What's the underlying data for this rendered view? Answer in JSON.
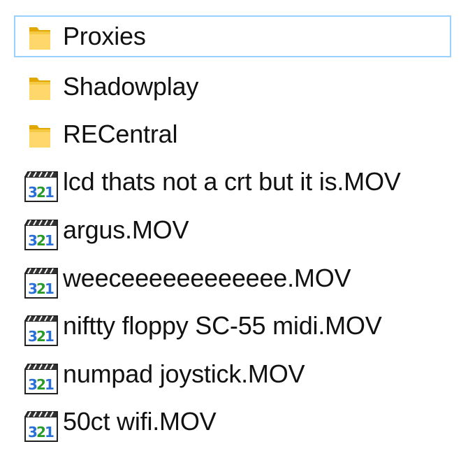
{
  "file_list": {
    "items": [
      {
        "name": "Proxies",
        "type": "folder",
        "selected": true
      },
      {
        "name": "Shadowplay",
        "type": "folder",
        "selected": false
      },
      {
        "name": "RECentral",
        "type": "folder",
        "selected": false
      },
      {
        "name": "lcd thats not a crt but it is.MOV",
        "type": "video",
        "selected": false
      },
      {
        "name": "argus.MOV",
        "type": "video",
        "selected": false
      },
      {
        "name": "weeceeeeeeeeeeee.MOV",
        "type": "video",
        "selected": false
      },
      {
        "name": "niftty floppy SC-55 midi.MOV",
        "type": "video",
        "selected": false
      },
      {
        "name": "numpad joystick.MOV",
        "type": "video",
        "selected": false
      },
      {
        "name": "50ct wifi.MOV",
        "type": "video",
        "selected": false
      }
    ],
    "icons": {
      "folder": "folder-icon",
      "video": "media-player-321-icon"
    },
    "colors": {
      "selection_border": "#99d1ff",
      "folder": "#f4c430",
      "text": "#111111"
    }
  }
}
